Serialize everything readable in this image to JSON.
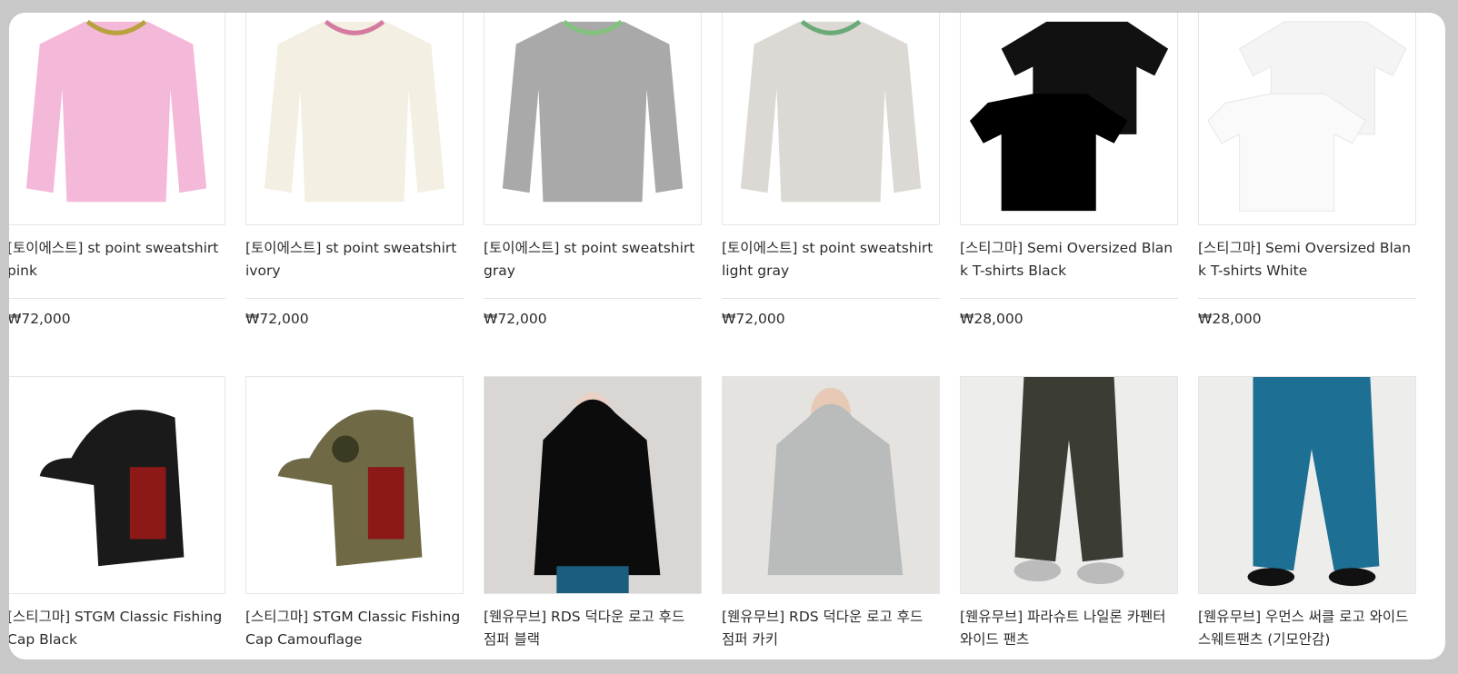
{
  "products": [
    {
      "name": "[토이에스트] st point sweatshirt pink",
      "price": "₩72,000",
      "icon": "pink-sweatshirt",
      "color": "#f4b8d8"
    },
    {
      "name": "[토이에스트] st point sweatshirt ivory",
      "price": "₩72,000",
      "icon": "ivory-sweatshirt",
      "color": "#f3efe2"
    },
    {
      "name": "[토이에스트] st point sweatshirt gray",
      "price": "₩72,000",
      "icon": "gray-sweatshirt",
      "color": "#a9a9a9"
    },
    {
      "name": "[토이에스트] st point sweatshirt light gray",
      "price": "₩72,000",
      "icon": "light-gray-sweatshirt",
      "color": "#dcd9d4"
    },
    {
      "name": "[스티그마] Semi Oversized Blank T-shirts Black",
      "price": "₩28,000",
      "icon": "black-tshirt",
      "color": "#111111"
    },
    {
      "name": "[스티그마] Semi Oversized Blank T-shirts White",
      "price": "₩28,000",
      "icon": "white-tshirt",
      "color": "#f6f6f6"
    },
    {
      "name": "[스티그마] STGM Classic Fishing Cap Black",
      "price": "",
      "icon": "black-cap",
      "color": "#1a1a1a"
    },
    {
      "name": "[스티그마] STGM Classic Fishing Cap Camouflage",
      "price": "",
      "icon": "camouflage-cap",
      "color": "#6f6a45"
    },
    {
      "name": "[웬유무브] RDS 덕다운 로고 후드 점퍼 블랙",
      "price": "",
      "icon": "black-puffer-jacket",
      "color": "#111111"
    },
    {
      "name": "[웬유무브] RDS 덕다운 로고 후드 점퍼 카키",
      "price": "",
      "icon": "khaki-puffer-jacket",
      "color": "#b9bcbb"
    },
    {
      "name": "[웬유무브] 파라슈트 나일론 카펜터 와이드 팬츠",
      "price": "",
      "icon": "nylon-wide-pants",
      "color": "#3b3d35"
    },
    {
      "name": "[웬유무브] 우먼스 써클 로고 와이드 스웨트팬츠 (기모안감)",
      "price": "",
      "icon": "blue-sweatpants",
      "color": "#1d6f93"
    }
  ]
}
